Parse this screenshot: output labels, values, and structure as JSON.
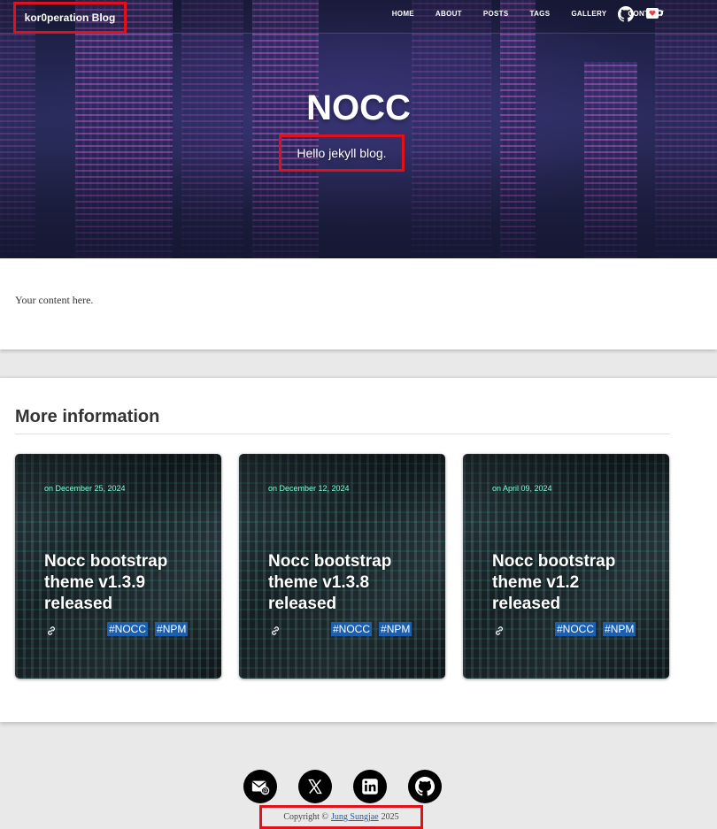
{
  "nav": {
    "brand": "kor0peration Blog",
    "menu": [
      "HOME",
      "ABOUT",
      "POSTS",
      "TAGS",
      "GALLERY",
      "CONTACT"
    ],
    "icons": [
      "github-icon",
      "coffee-cup-icon"
    ]
  },
  "hero": {
    "title": "NOCC",
    "subtitle": "Hello jekyll blog."
  },
  "content": {
    "text": "Your content here."
  },
  "more": {
    "heading": "More information",
    "cards": [
      {
        "date": "on December 25, 2024",
        "title": "Nocc bootstrap theme v1.3.9 released",
        "tags": [
          "#NOCC",
          "#NPM"
        ]
      },
      {
        "date": "on December 12, 2024",
        "title": "Nocc bootstrap theme v1.3.8 released",
        "tags": [
          "#NOCC",
          "#NPM"
        ]
      },
      {
        "date": "on April 09, 2024",
        "title": "Nocc bootstrap theme v1.2 released",
        "tags": [
          "#NOCC",
          "#NPM"
        ]
      }
    ]
  },
  "footer": {
    "social_icons": [
      "email-icon",
      "x-icon",
      "linkedin-icon",
      "github-icon"
    ],
    "copyright_prefix": "Copyright ©",
    "author": "Jung Sungjae",
    "year": "2025"
  },
  "colors": {
    "highlight_box": "#e3101a",
    "accent_date": "#7fffd4",
    "tag_bg": "#1a5fb0"
  }
}
